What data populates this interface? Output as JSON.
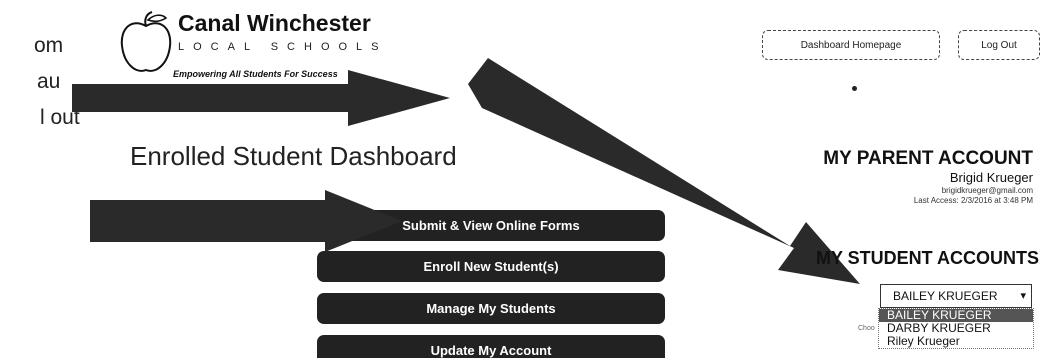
{
  "fragments": [
    "om",
    "au",
    "l out"
  ],
  "logo": {
    "name": "Canal Winchester",
    "sub": "LOCAL SCHOOLS",
    "tagline": "Empowering All Students For Success"
  },
  "header": {
    "home_button": "Dashboard Homepage",
    "logout_button": "Log Out"
  },
  "dashboard": {
    "title": "Enrolled Student Dashboard",
    "menu": [
      "Submit & View Online Forms",
      "Enroll New Student(s)",
      "Manage My Students",
      "Update My Account"
    ]
  },
  "parent_account": {
    "heading": "MY PARENT ACCOUNT",
    "name": "Brigid Krueger",
    "email": "brigidkrueger@gmail.com",
    "last_access": "Last Access: 2/3/2016 at 3:48 PM"
  },
  "student_accounts": {
    "heading": "MY STUDENT ACCOUNTS",
    "selected": "BAILEY KRUEGER",
    "options": [
      "BAILEY KRUEGER",
      "DARBY KRUEGER",
      "Riley Krueger"
    ],
    "choose_label": "Choo"
  },
  "colors": {
    "menu_bg": "#222222",
    "arrow": "#2a2a2a"
  }
}
